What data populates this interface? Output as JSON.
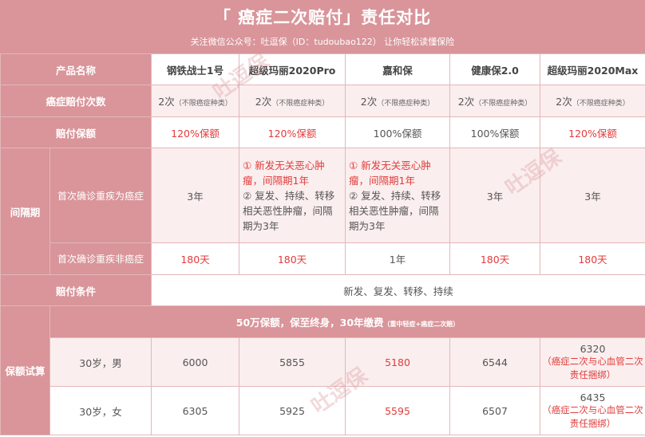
{
  "header": {
    "title": "「 癌症二次赔付」责任对比",
    "subtitle": "关注微信公众号：吐逗保（ID：tudoubao122）   让你轻松读懂保险"
  },
  "labels": {
    "product_name": "产品名称",
    "claim_times": "癌症赔付次数",
    "claim_amount": "赔付保额",
    "interval": "间隔期",
    "interval_cancer": "首次确诊重疾为癌症",
    "interval_noncancer": "首次确诊重疾非癌症",
    "claim_condition": "赔付条件",
    "premium_test": "保额试算",
    "premium_header_main": "50万保额，保至终身，30年缴费",
    "premium_header_note": "（重中轻症+癌症二次赔）",
    "row_male": "30岁，男",
    "row_female": "30岁，女"
  },
  "products": [
    "钢铁战士1号",
    "超级玛丽2020Pro",
    "嘉和保",
    "健康保2.0",
    "超级玛丽2020Max"
  ],
  "claim_times": {
    "value": "2次",
    "note": "（不限癌症种类）"
  },
  "claim_amount": [
    "120%保额",
    "120%保额",
    "100%保额",
    "100%保额",
    "120%保额"
  ],
  "interval_cancer": {
    "plain": "3年",
    "note_line1": "① 新发无关恶心肿瘤，间隔期1年",
    "note_line2": "② 复发、持续、转移相关恶性肿瘤，间隔期为3年"
  },
  "interval_noncancer": [
    "180天",
    "180天",
    "1年",
    "180天",
    "180天"
  ],
  "claim_condition": "新发、复发、转移、持续",
  "premium_male": [
    "6000",
    "5855",
    "5180",
    "6544",
    "6320"
  ],
  "premium_female": [
    "6305",
    "5925",
    "5595",
    "6507",
    "6435"
  ],
  "premium_max_note": "（癌症二次与心血管二次责任捆绑）",
  "watermark": "吐逗保"
}
